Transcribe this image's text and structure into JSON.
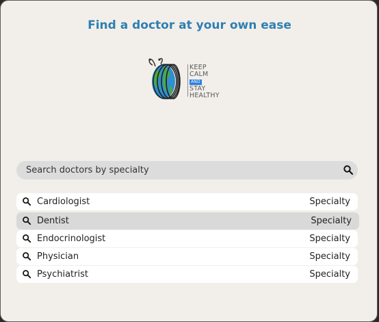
{
  "header": {
    "title": "Find a doctor at your own ease"
  },
  "logo": {
    "line1": "KEEP",
    "line2": "CALM",
    "line3": "AND",
    "line4": "STAY",
    "line5": "HEALTHY"
  },
  "search": {
    "placeholder": "Search doctors by specialty",
    "icon": "search-icon"
  },
  "results": [
    {
      "name": "Cardiologist",
      "tag": "Specialty",
      "highlighted": false
    },
    {
      "name": "Dentist",
      "tag": "Specialty",
      "highlighted": true
    },
    {
      "name": "Endocrinologist",
      "tag": "Specialty",
      "highlighted": false
    },
    {
      "name": "Physician",
      "tag": "Specialty",
      "highlighted": false
    },
    {
      "name": "Psychiatrist",
      "tag": "Specialty",
      "highlighted": false
    }
  ],
  "colors": {
    "background": "#f2efea",
    "title": "#2f7fb2",
    "search_bg": "#dcdcdc",
    "row_bg": "#ffffff",
    "row_highlight": "#d9d9d9"
  }
}
